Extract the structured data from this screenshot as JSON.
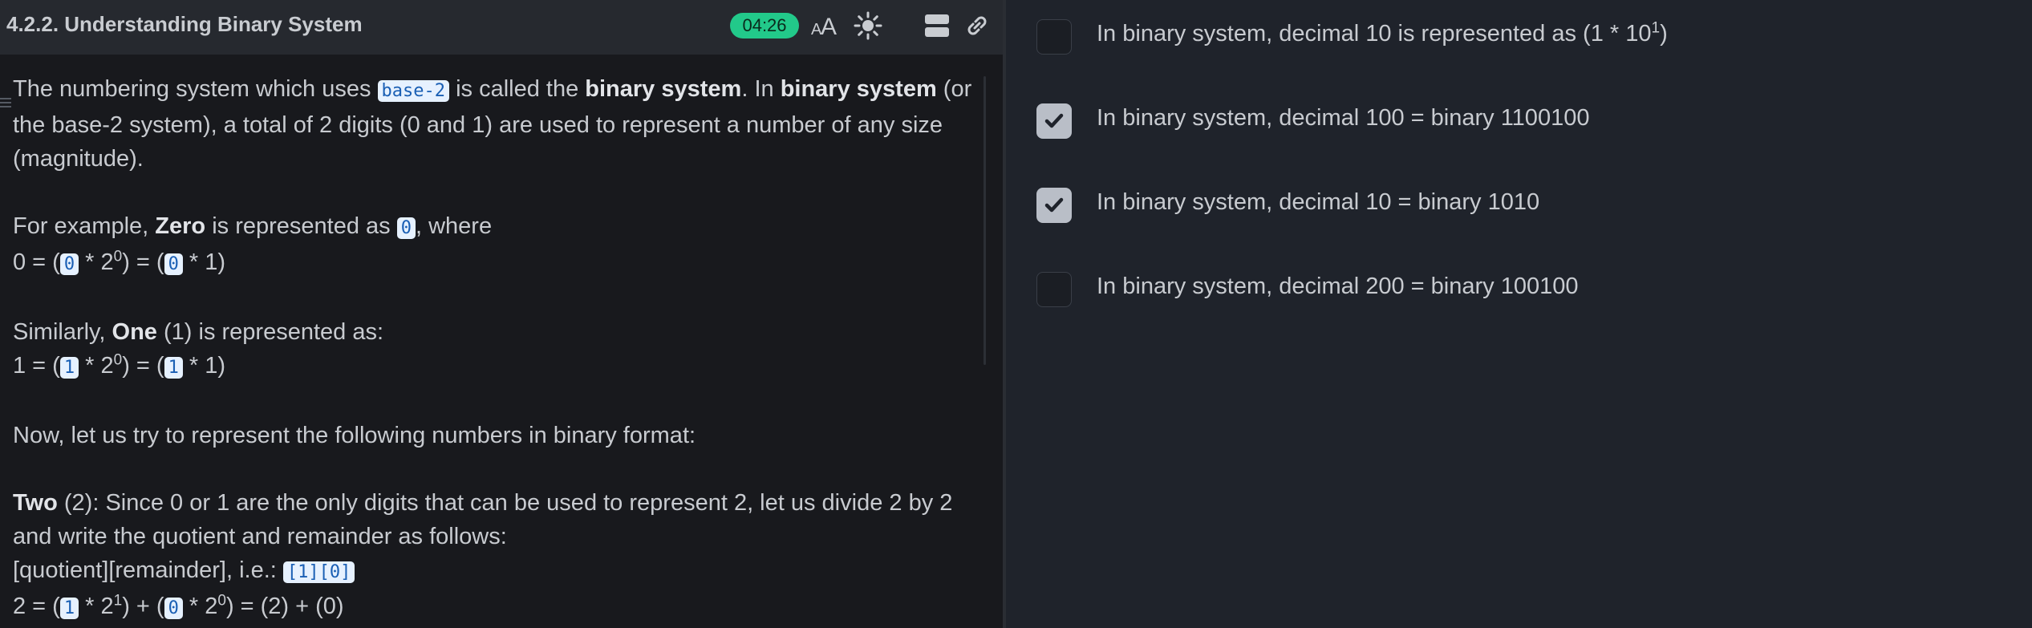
{
  "header": {
    "title": "4.2.2. Understanding Binary System",
    "timer": "04:26",
    "icons": [
      "font-size-icon",
      "theme-brightness-icon",
      "layout-toggle-icon",
      "link-icon"
    ]
  },
  "lesson": {
    "p1": {
      "t1": "The numbering system which uses ",
      "code": "base-2",
      "t2": " is called the ",
      "b1": "binary system",
      "t3": ". In ",
      "b2": "binary system",
      "t4": " (or the base-2 system), a total of 2 digits (0 and 1) are used to represent a number of any size (magnitude)."
    },
    "p2": {
      "t1": "For example, ",
      "b1": "Zero",
      "t2": " is represented as ",
      "code": "0",
      "t3": ", where"
    },
    "p3": {
      "t1": "0 = (",
      "c1": "0",
      "t2": " * 2",
      "sup1": "0",
      "t3": ") = (",
      "c2": "0",
      "t4": " * 1)"
    },
    "p4": {
      "t1": "Similarly, ",
      "b1": "One",
      "t2": " (1) is represented as:"
    },
    "p5": {
      "t1": "1 = (",
      "c1": "1",
      "t2": " * 2",
      "sup1": "0",
      "t3": ") = (",
      "c2": "1",
      "t4": " * 1)"
    },
    "p6": "Now, let us try to represent the following numbers in binary format:",
    "p7": {
      "b1": "Two",
      "t1": " (2): Since 0 or 1 are the only digits that can be used to represent 2, let us divide 2 by 2 and write the quotient and remainder as follows:"
    },
    "p8": {
      "t1": "[quotient][remainder], i.e.: ",
      "code": "[1][0]"
    },
    "p9": {
      "t1": "2 = (",
      "c1": "1",
      "t2": " * 2",
      "sup1": "1",
      "t3": ") + (",
      "c2": "0",
      "t4": " * 2",
      "sup2": "0",
      "t5": ") = (2) + (0)"
    }
  },
  "options": [
    {
      "text": "In binary system, decimal 10 is represented as (1 * 10",
      "sup": "1",
      "text_after": ")",
      "checked": false
    },
    {
      "text": "In binary system, decimal 100 = binary 1100100",
      "sup": "",
      "text_after": "",
      "checked": true
    },
    {
      "text": "In binary system, decimal 10 = binary 1010",
      "sup": "",
      "text_after": "",
      "checked": true
    },
    {
      "text": "In binary system, decimal 200 = binary 100100",
      "sup": "",
      "text_after": "",
      "checked": false
    }
  ],
  "colors": {
    "timer_bg": "#22c98a",
    "code_bg": "#e6f1ff",
    "code_text": "#1a5fb4",
    "checkbox_checked": "#b9bec7"
  }
}
